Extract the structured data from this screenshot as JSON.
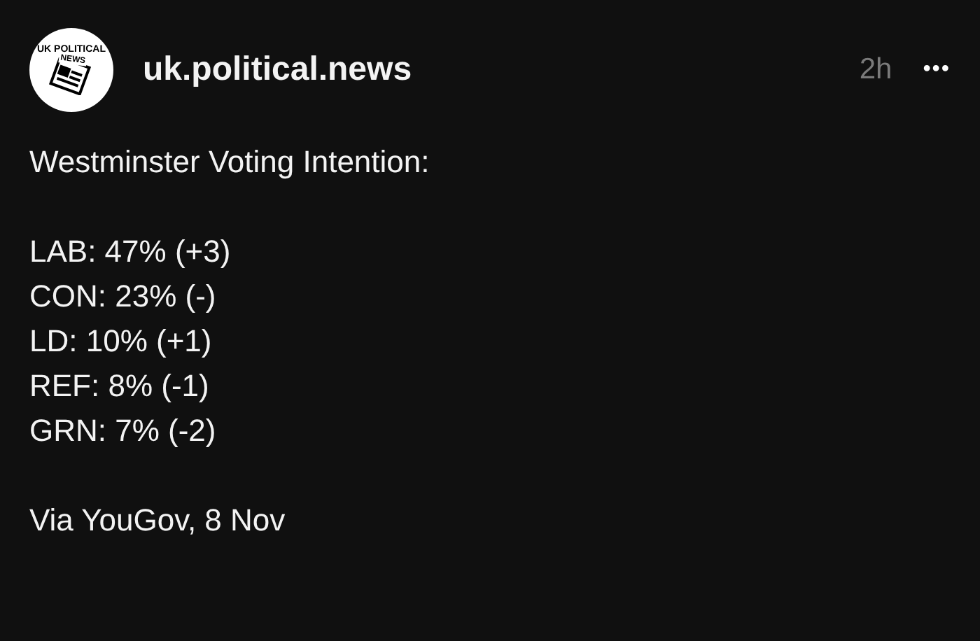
{
  "post": {
    "avatar": {
      "top_text": "UK POLITICAL",
      "badge_text": "NEWS"
    },
    "username": "uk.political.news",
    "time": "2h",
    "more": "•••",
    "heading": "Westminster Voting Intention:",
    "results": [
      "LAB: 47% (+3)",
      "CON: 23% (-)",
      "LD: 10% (+1)",
      "REF: 8% (-1)",
      "GRN: 7% (-2)"
    ],
    "source": "Via YouGov, 8 Nov"
  }
}
